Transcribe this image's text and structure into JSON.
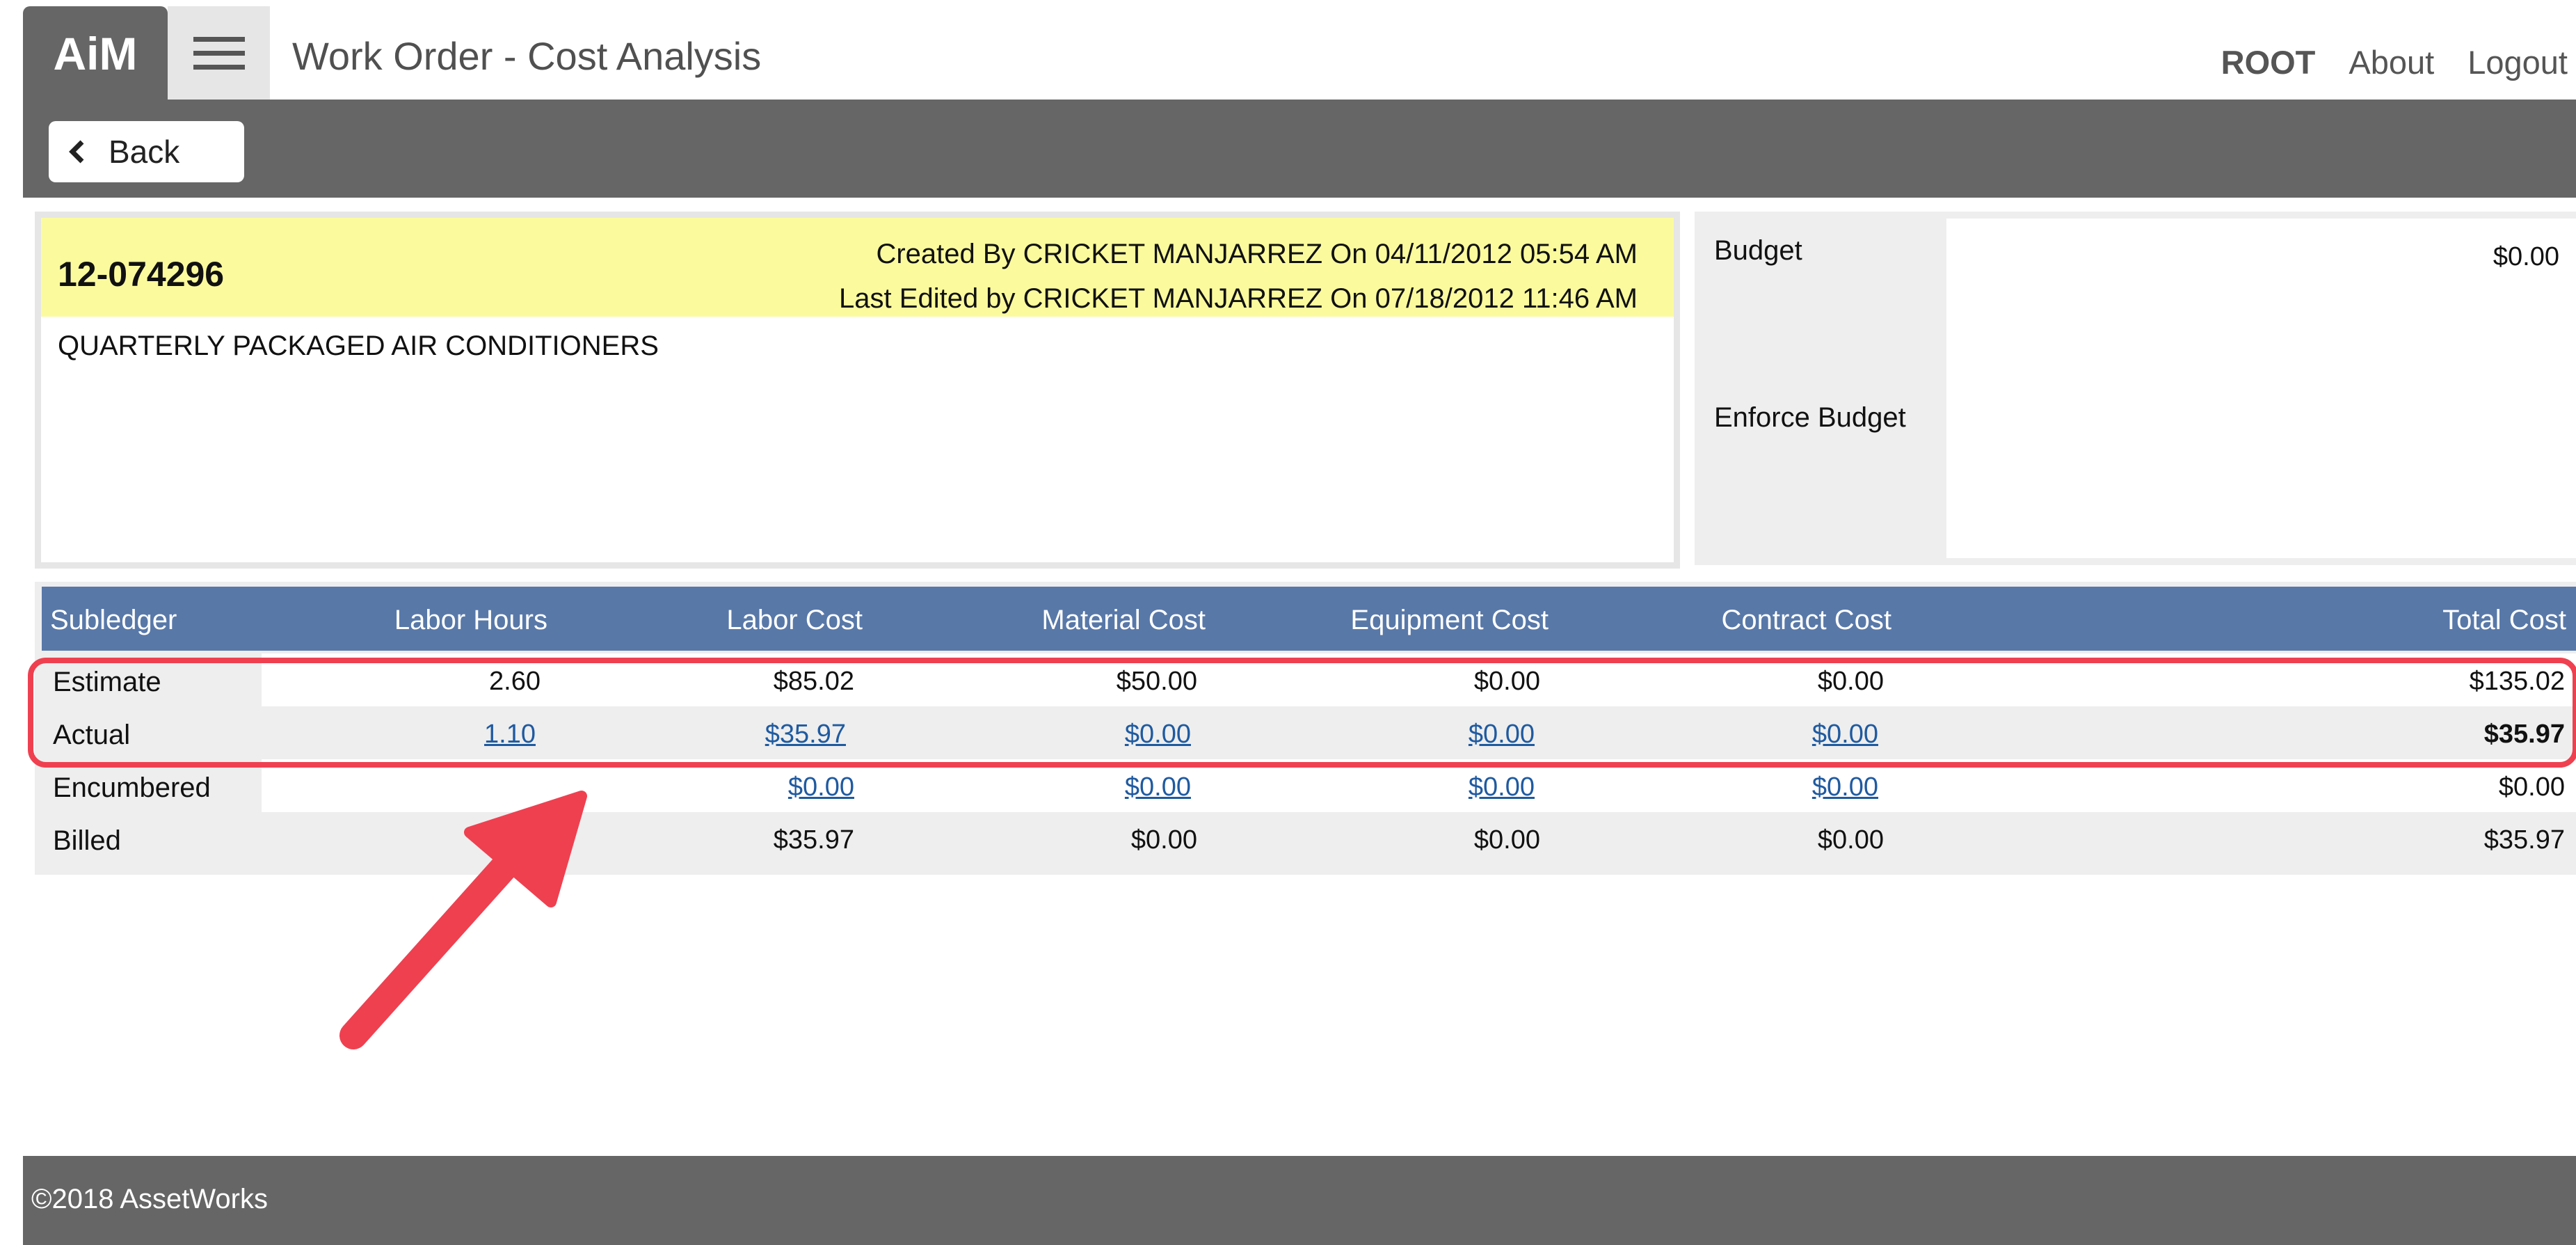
{
  "app": {
    "logo": "AiM",
    "title": "Work Order - Cost Analysis"
  },
  "nav": {
    "user": "ROOT",
    "about": "About",
    "logout": "Logout"
  },
  "toolbar": {
    "back_label": "Back"
  },
  "work_order": {
    "number": "12-074296",
    "created": "Created By CRICKET MANJARREZ On 04/11/2012 05:54 AM",
    "edited": "Last Edited by CRICKET MANJARREZ On 07/18/2012 11:46 AM",
    "description": "QUARTERLY PACKAGED AIR CONDITIONERS"
  },
  "budget": {
    "budget_label": "Budget",
    "budget_value": "$0.00",
    "enforce_label": "Enforce Budget"
  },
  "table": {
    "headers": [
      "Subledger",
      "Labor Hours",
      "Labor Cost",
      "Material Cost",
      "Equipment Cost",
      "Contract Cost",
      "Total Cost"
    ],
    "rows": [
      {
        "label": "Estimate",
        "hours": "2.60",
        "labor": "$85.02",
        "material": "$50.00",
        "equipment": "$0.00",
        "contract": "$0.00",
        "total": "$135.02"
      },
      {
        "label": "Actual",
        "hours": "1.10",
        "labor": "$35.97",
        "material": "$0.00",
        "equipment": "$0.00",
        "contract": "$0.00",
        "total": "$35.97"
      },
      {
        "label": "Encumbered",
        "hours": "",
        "labor": "$0.00",
        "material": "$0.00",
        "equipment": "$0.00",
        "contract": "$0.00",
        "total": "$0.00"
      },
      {
        "label": "Billed",
        "hours": "",
        "labor": "$35.97",
        "material": "$0.00",
        "equipment": "$0.00",
        "contract": "$0.00",
        "total": "$35.97"
      }
    ]
  },
  "annotation": {
    "highlight_color": "#ef4050",
    "arrow_color": "#ef4050"
  },
  "footer": {
    "copyright": "©2018 AssetWorks"
  }
}
